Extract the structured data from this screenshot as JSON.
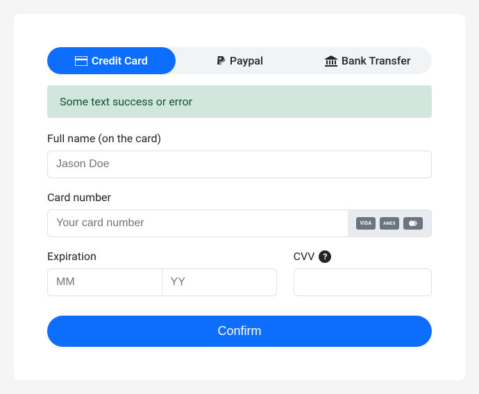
{
  "tabs": {
    "credit_card": "Credit Card",
    "paypal": "Paypal",
    "bank_transfer": "Bank Transfer"
  },
  "alert": {
    "message": "Some text success or error"
  },
  "form": {
    "full_name_label": "Full name (on the card)",
    "full_name_placeholder": "Jason Doe",
    "card_number_label": "Card number",
    "card_number_placeholder": "Your card number",
    "expiration_label": "Expiration",
    "exp_mm_placeholder": "MM",
    "exp_yy_placeholder": "YY",
    "cvv_label": "CVV",
    "confirm_label": "Confirm"
  },
  "card_brands": {
    "visa": "VISA",
    "amex": "AMEX"
  }
}
